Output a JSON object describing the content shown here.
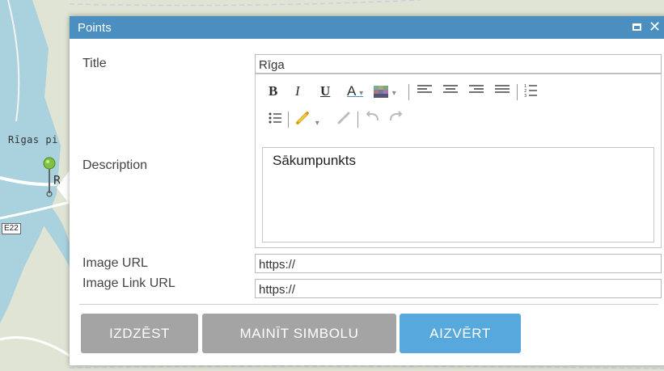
{
  "map": {
    "place_label": "Rīgas pi",
    "pin_label_fragment": "R",
    "road_shield": "E22",
    "colors": {
      "land": "#dfe4d4",
      "water": "#a9d1de",
      "road": "#ffffff"
    }
  },
  "popup": {
    "title": "Points",
    "titlebar_color": "#4a8fc0",
    "controls": {
      "maximize_icon": "maximize-icon",
      "close_icon": "close-icon",
      "close_glyph": "✕"
    },
    "fields": {
      "title_label": "Title",
      "title_value": "Rīga",
      "description_label": "Description",
      "description_value": "Sākumpunkts",
      "image_url_label": "Image URL",
      "image_url_value": "https://",
      "image_link_url_label": "Image Link URL",
      "image_link_url_value": "https://"
    },
    "toolbar": {
      "bold": "B",
      "italic": "I",
      "underline": "U",
      "font_color": "A",
      "dropdown_caret": "▾",
      "icons": [
        "bold-icon",
        "italic-icon",
        "underline-icon",
        "font-color-icon",
        "background-color-icon",
        "align-left-icon",
        "align-center-icon",
        "align-right-icon",
        "justify-icon",
        "numbered-list-icon",
        "bulleted-list-icon",
        "link-icon",
        "unlink-icon",
        "undo-icon",
        "redo-icon"
      ]
    },
    "buttons": {
      "delete": "IZDZĒST",
      "change_symbol": "MAINĪT SIMBOLU",
      "close": "AIZVĒRT"
    },
    "button_colors": {
      "secondary": "#a4a4a4",
      "primary": "#57a8dc"
    }
  }
}
